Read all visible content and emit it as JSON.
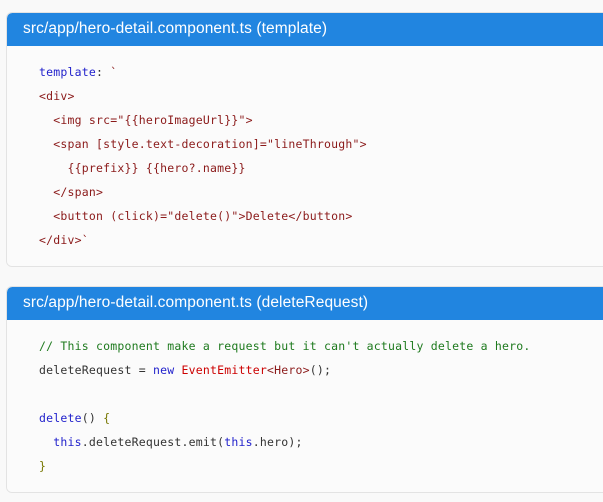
{
  "panels": [
    {
      "id": "template",
      "title": "src/app/hero-detail.component.ts (template)",
      "header_color": "#2185e0",
      "lines": [
        "template: `",
        "<div>",
        "  <img src=\"{{heroImageUrl}}\">",
        "  <span [style.text-decoration]=\"lineThrough\">",
        "    {{prefix}} {{hero?.name}}",
        "  </span>",
        "  <button (click)=\"delete()\">Delete</button>",
        "</div>`"
      ]
    },
    {
      "id": "deleteRequest",
      "title": "src/app/hero-detail.component.ts (deleteRequest)",
      "header_color": "#2185e0",
      "lines": [
        "// This component make a request but it can't actually delete a hero.",
        "deleteRequest = new EventEmitter<Hero>();",
        "",
        "delete() {",
        "  this.deleteRequest.emit(this.hero);",
        "}"
      ]
    }
  ],
  "code_template_html": "<span class=\"t-key\">template</span><span class=\"t-plain\">: </span><span class=\"t-tag\">`</span>\n<span class=\"t-tag\">&lt;div&gt;</span>\n  <span class=\"t-tag\">&lt;img src=\"{{heroImageUrl}}\"&gt;</span>\n  <span class=\"t-tag\">&lt;span [style.text-decoration]=\"lineThrough\"&gt;</span>\n    <span class=\"t-tag\">{{prefix}} {{hero?.name}}</span>\n  <span class=\"t-tag\">&lt;/span&gt;</span>\n  <span class=\"t-tag\">&lt;button (click)=\"delete()\"&gt;Delete&lt;/button&gt;</span>\n<span class=\"t-tag\">&lt;/div&gt;`</span>",
  "code_delete_html": "<span class=\"t-cmt\">// This component make a request but it can't actually delete a hero.</span>\n<span class=\"t-plain\">deleteRequest = </span><span class=\"t-key\">new</span><span class=\"t-plain\"> </span><span class=\"t-type\">EventEmitter</span><span class=\"t-tag\">&lt;Hero&gt;</span><span class=\"t-plain\">();</span>\n\n<span class=\"t-key\">delete</span><span class=\"t-plain\">() </span><span class=\"t-punc\">{</span>\n  <span class=\"t-key\">this</span><span class=\"t-plain\">.deleteRequest.emit(</span><span class=\"t-key\">this</span><span class=\"t-plain\">.hero);</span>\n<span class=\"t-punc\">}</span>",
  "colors": {
    "header_blue": "#2185e0",
    "page_background": "#f9f9f9",
    "panel_background": "#fbfbfb",
    "panel_border": "#e3e3e3",
    "code_text": "#333333",
    "keyword": "#2222cc",
    "tag": "#8b1a1a",
    "comment": "#1e7a1e",
    "type": "#cc0000",
    "brace": "#777700"
  }
}
